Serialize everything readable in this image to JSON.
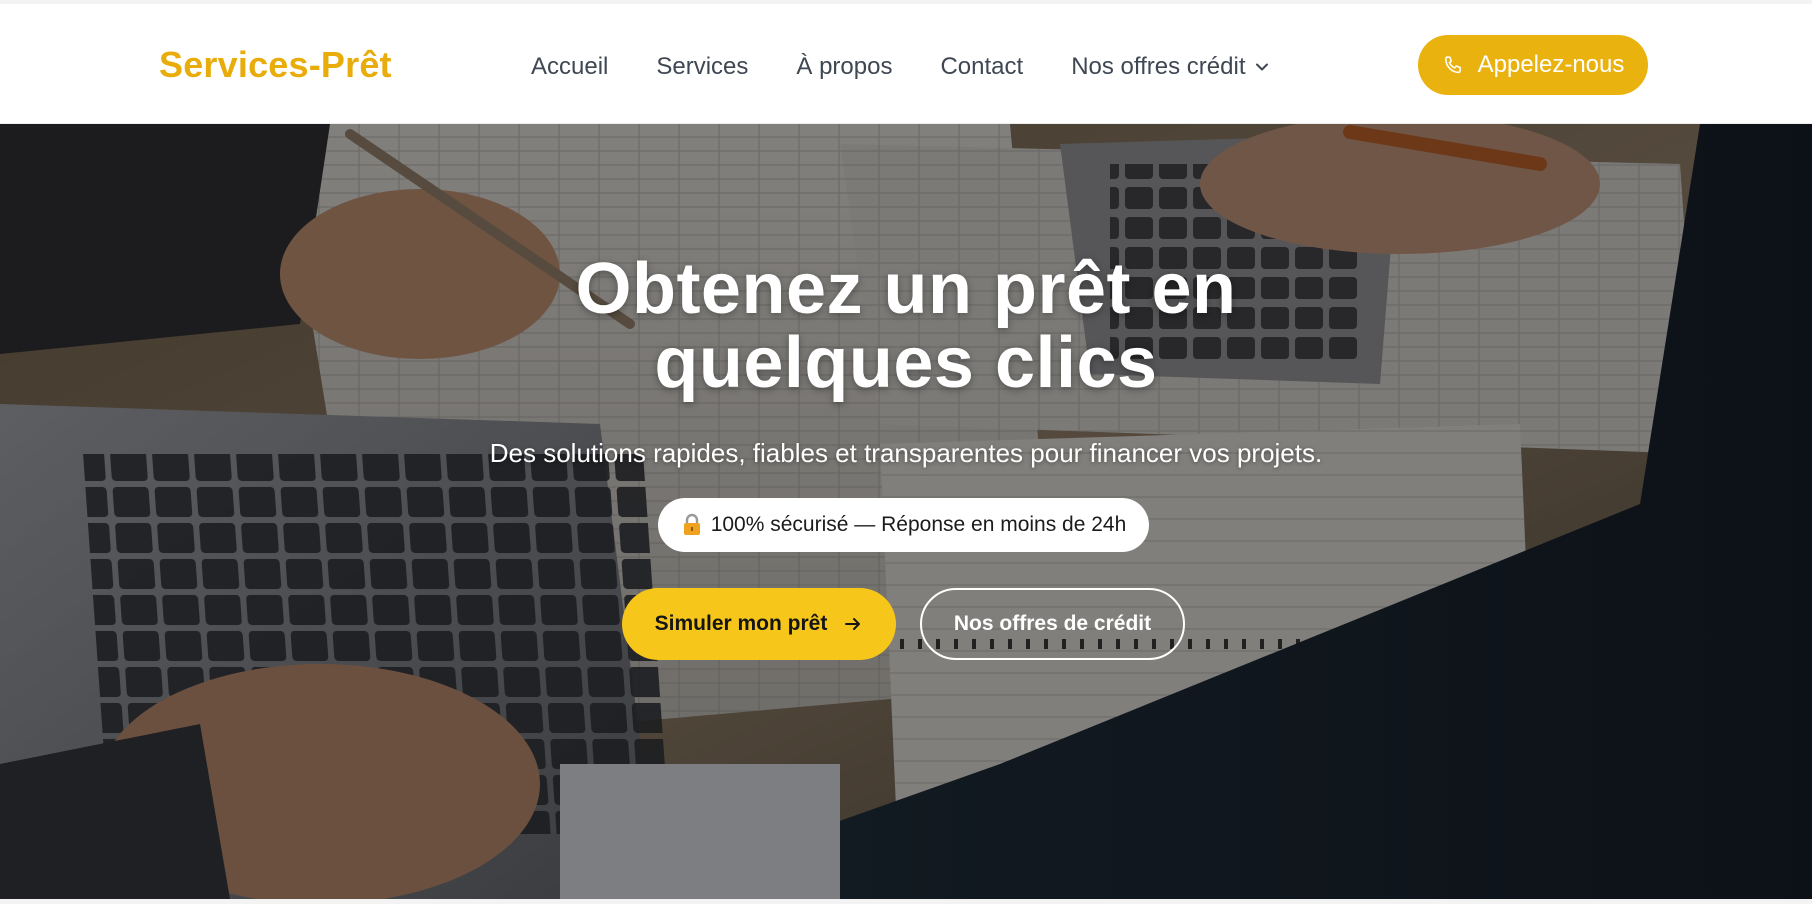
{
  "navbar": {
    "logo": "Services-Prêt",
    "links": [
      {
        "label": "Accueil"
      },
      {
        "label": "Services"
      },
      {
        "label": "À propos"
      },
      {
        "label": "Contact"
      }
    ],
    "dropdown_label": "Nos offres crédit",
    "call_button_label": "Appelez-nous"
  },
  "hero": {
    "title_line1": "Obtenez un prêt en",
    "title_line2": "quelques clics",
    "subtitle": "Des solutions rapides, fiables et transparentes pour financer vos projets.",
    "badge": "100% sécurisé — Réponse en moins de 24h",
    "primary_button": "Simuler mon prêt",
    "secondary_button": "Nos offres de crédit"
  },
  "colors": {
    "brand_gold": "#e8ad0b",
    "call_button": "#e9b20f",
    "primary_button": "#f6c61a",
    "nav_text": "#3f4753"
  },
  "icons": {
    "call": "phone-icon",
    "dropdown": "chevron-down-icon",
    "badge": "lock-icon",
    "primary": "arrow-right-icon"
  }
}
